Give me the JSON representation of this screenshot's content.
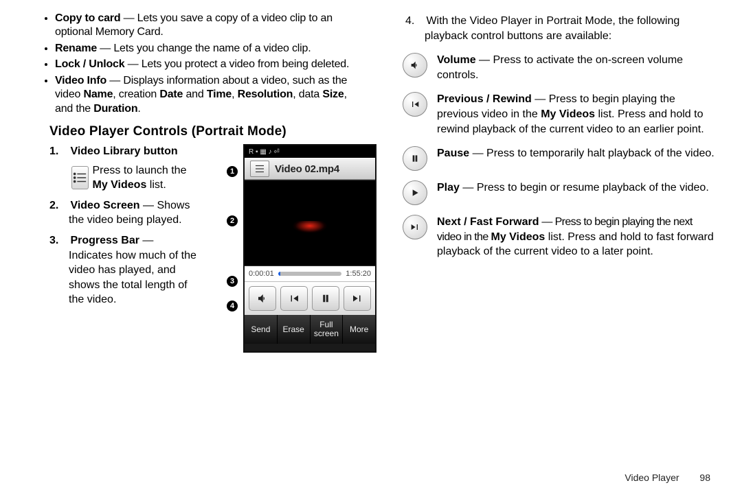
{
  "left": {
    "bullets": [
      {
        "b": "Copy to card",
        "t": " — Lets you save a copy of a video clip to an optional Memory Card."
      },
      {
        "b": "Rename",
        "t": " — Lets you change the name of a video clip."
      },
      {
        "b": "Lock / Unlock",
        "t": " — Lets you protect a video from being deleted."
      },
      {
        "b": "Video Info",
        "t": " — Displays information about a video, such as the video Name, creation Date and Time, Resolution, data Size, and the Duration."
      }
    ],
    "heading": "Video Player Controls (Portrait Mode)",
    "numbered": {
      "one_b": "Video Library button",
      "one_t1": "Press to launch the ",
      "one_t2": "My Videos",
      "one_t3": " list.",
      "two_b": "Video Screen",
      "two_t": " — Shows the video being played.",
      "three_b": "Progress Bar",
      "three_t": " — Indicates how much of the video has played, and shows the total length of the video."
    }
  },
  "right": {
    "four_t": "With the Video Player in Portrait Mode, the following playback control buttons are available:",
    "rows": {
      "volume": {
        "b": "Volume",
        "t": " — Press to activate the on-screen volume controls."
      },
      "prev": {
        "b": "Previous / Rewind",
        "t1": " — Press to begin playing the previous video in the ",
        "t2": "My Videos",
        "t3": " list. Press and hold to rewind playback of the current video to an earlier point."
      },
      "pause": {
        "b": "Pause",
        "t": " — Press to temporarily halt playback of the video."
      },
      "play": {
        "b": "Play",
        "t": " — Press to begin or resume playback of the video."
      },
      "next": {
        "b": "Next / Fast Forward",
        "t1": " — Press to begin playing the next video in the ",
        "t2": "My Videos",
        "t3": " list. Press and hold to fast forward playback of the current video to a later point."
      }
    }
  },
  "figure": {
    "status": "R ▪ ▦ ♪ ⏎",
    "title": "Video 02.mp4",
    "elapsed": "0:00:01",
    "total": "1:55:20",
    "soft": [
      "Send",
      "Erase",
      "Full screen",
      "More"
    ],
    "callouts": [
      "1",
      "2",
      "3",
      "4"
    ]
  },
  "footer": {
    "section": "Video Player",
    "page": "98"
  }
}
